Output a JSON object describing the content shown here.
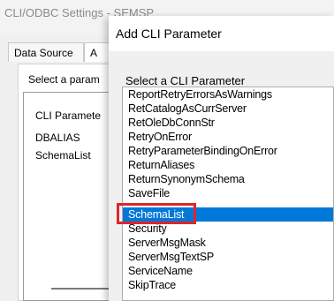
{
  "background_window": {
    "title": "CLI/ODBC Settings - SEMSP",
    "tabs": [
      "Data Source",
      "A"
    ],
    "select_label": "Select a param",
    "list_header": "CLI Paramete",
    "list_items": [
      "DBALIAS",
      "SchemaList"
    ]
  },
  "dialog": {
    "title": "Add CLI Parameter",
    "select_label": "Select a CLI Parameter",
    "parameters": [
      "ReportRetryErrorsAsWarnings",
      "RetCatalogAsCurrServer",
      "RetOleDbConnStr",
      "RetryOnError",
      "RetryParameterBindingOnError",
      "ReturnAliases",
      "ReturnSynonymSchema",
      "SaveFile",
      "SchemaList",
      "Security",
      "ServerMsgMask",
      "ServerMsgTextSP",
      "ServiceName",
      "SkipTrace"
    ],
    "selected": "SchemaList",
    "colors": {
      "selection": "#0078d7",
      "highlight_box": "#e0242c"
    }
  }
}
